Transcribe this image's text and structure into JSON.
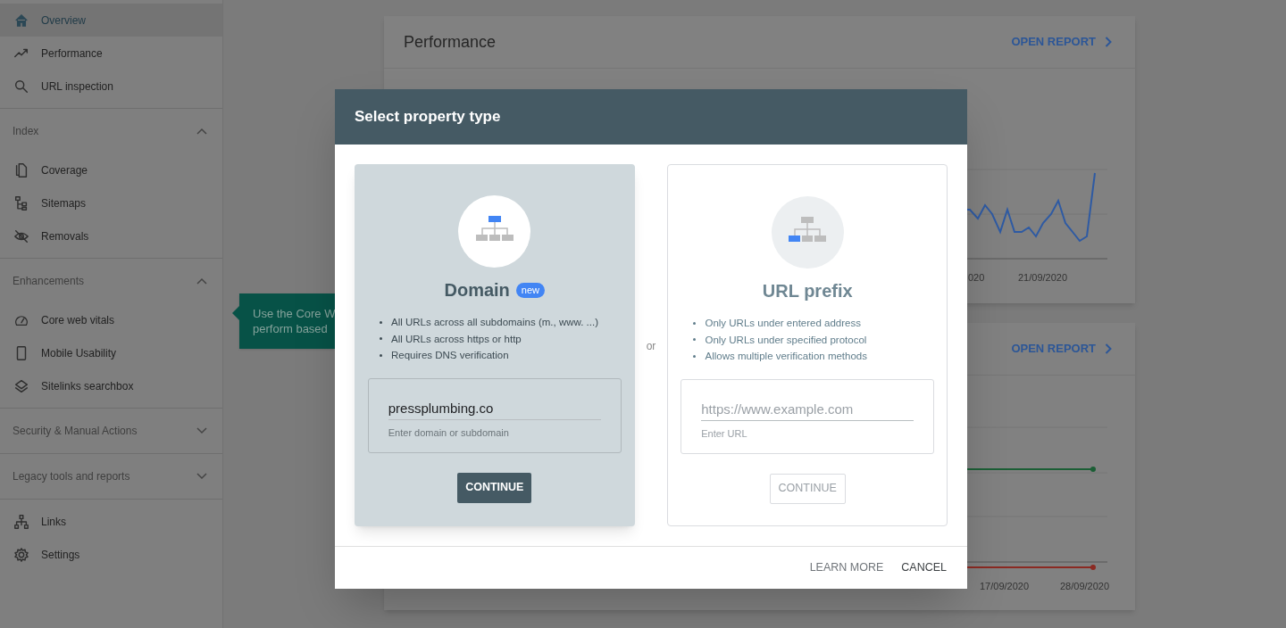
{
  "sidebar": {
    "groups": [
      {
        "items": [
          {
            "label": "Overview",
            "selected": true
          },
          {
            "label": "Performance",
            "selected": false
          },
          {
            "label": "URL inspection",
            "selected": false
          }
        ]
      },
      {
        "title": "Index",
        "expanded": true,
        "items": [
          {
            "label": "Coverage",
            "selected": false
          },
          {
            "label": "Sitemaps",
            "selected": false
          },
          {
            "label": "Removals",
            "selected": false
          }
        ]
      },
      {
        "title": "Enhancements",
        "expanded": true,
        "items": [
          {
            "label": "Core web vitals",
            "selected": false
          },
          {
            "label": "Mobile Usability",
            "selected": false
          },
          {
            "label": "Sitelinks searchbox",
            "selected": false
          }
        ]
      },
      {
        "title": "Security & Manual Actions",
        "expanded": false
      },
      {
        "title": "Legacy tools and reports",
        "expanded": false
      },
      {
        "items": [
          {
            "label": "Links",
            "selected": false
          },
          {
            "label": "Settings",
            "selected": false
          }
        ]
      }
    ]
  },
  "tooltip": {
    "lines": [
      "Use the Core W",
      "perform based"
    ]
  },
  "cards": [
    {
      "title": "Performance",
      "action": "OPEN REPORT",
      "x_labels": [
        "020",
        "21/09/2020"
      ]
    },
    {
      "action": "OPEN REPORT",
      "x_labels": [
        "17/09/2020",
        "28/09/2020"
      ]
    }
  ],
  "dialog": {
    "title": "Select property type",
    "separator": "or",
    "options": [
      {
        "title": "Domain",
        "badge": "new",
        "selected": true,
        "bullets": [
          "All URLs across all subdomains (m., www. ...)",
          "All URLs across https or http",
          "Requires DNS verification"
        ],
        "field": {
          "value": "pressplumbing.co",
          "helper": "Enter domain or subdomain"
        },
        "button": "CONTINUE"
      },
      {
        "title": "URL prefix",
        "selected": false,
        "bullets": [
          "Only URLs under entered address",
          "Only URLs under specified protocol",
          "Allows multiple verification methods"
        ],
        "field": {
          "placeholder": "https://www.example.com",
          "helper": "Enter URL"
        },
        "button": "CONTINUE"
      }
    ],
    "buttons": [
      "LEARN MORE",
      "CANCEL"
    ]
  }
}
